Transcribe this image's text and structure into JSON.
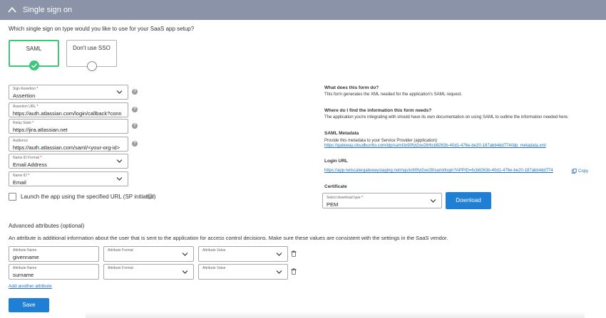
{
  "header": {
    "title": "Single sign on"
  },
  "question": "Which single sign on type would you like to use for your SaaS app setup?",
  "sso_options": [
    {
      "label": "SAML",
      "selected": true
    },
    {
      "label": "Don't use SSO",
      "selected": false
    }
  ],
  "fields": {
    "sign_assertion": {
      "label": "Sign Assertion",
      "value": "Assertion"
    },
    "assertion_url": {
      "label": "Assertion URL",
      "value": "https://auth.atlassian.com/login/callback?conn"
    },
    "relay_state": {
      "label": "Relay State",
      "value": "https://jira.atlassian.net"
    },
    "audience": {
      "label": "Audience",
      "value": "https://auth.atlassian.com/saml/<your-org-id>"
    },
    "name_id_format": {
      "label": "Name ID Format",
      "value": "Email Address"
    },
    "name_id": {
      "label": "Name ID",
      "value": "Email"
    }
  },
  "required_mark": "*",
  "help_glyph": "?",
  "launch_checkbox": {
    "label": "Launch the app using the specified URL (SP initiated)",
    "checked": false
  },
  "info": {
    "what_title": "What does this form do?",
    "what_text": "This form generates the XML needed for the application's SAML request.",
    "where_title": "Where do I find the information this form needs?",
    "where_text": "The application you're integrating with should have its own documentation on using SAML to outline the information needed here.",
    "metadata_title": "SAML Metadata",
    "metadata_text": "Provide this metadata to your Service Provider (application)",
    "metadata_link": "https://gateway.cloudburrito.com/idp/saml/io90fyt2xe28/6cb8263b-40d1-476e-be20-187abb4dd774/idp_metadata.xml",
    "login_title": "Login URL",
    "login_link": "https://app.netscalergatewaystaging.net/ngs/io90fyt2xe28/saml/login?APPID=6cb8263b-40d1-476e-be20-187abb4dd774",
    "copy_label": "Copy",
    "cert_title": "Certificate",
    "cert_select_label": "Select download type",
    "cert_select_value": "PEM",
    "download_label": "Download"
  },
  "advanced": {
    "title": "Advanced attributes (optional)",
    "description": "An attribute is additional information about the user that is sent to the application for access control decisions. Make sure these values are consistent with the settings in the SaaS vendor.",
    "name_label": "Attribute Name",
    "format_label": "Attribute Format",
    "value_label": "Attribute Value",
    "rows": [
      {
        "name": "givenname"
      },
      {
        "name": "surname"
      }
    ],
    "add_label": "Add another attribute"
  },
  "save_label": "Save",
  "colors": {
    "header": "#8a93a8",
    "accent": "#1f7fd4",
    "selected": "#3ec77a",
    "link": "#1f6fc6"
  }
}
